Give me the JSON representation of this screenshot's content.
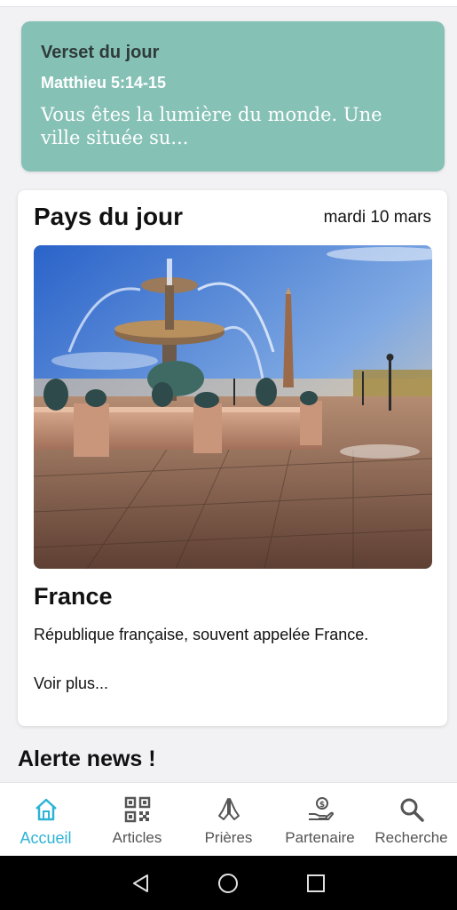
{
  "verse": {
    "title": "Verset du jour",
    "reference": "Matthieu 5:14-15",
    "text": "Vous êtes la lumière du monde. Une ville située su..."
  },
  "country_card": {
    "title": "Pays du jour",
    "date": "mardi 10 mars",
    "image_icon": "place-de-la-concorde-photo",
    "country": "France",
    "description": "République française, souvent appelée France.",
    "more_link": "Voir plus..."
  },
  "alerts": {
    "title": "Alerte news !"
  },
  "nav": {
    "items": [
      {
        "label": "Accueil",
        "icon": "home-icon",
        "active": true
      },
      {
        "label": "Articles",
        "icon": "qr-code-icon",
        "active": false
      },
      {
        "label": "Prières",
        "icon": "praying-hands-icon",
        "active": false
      },
      {
        "label": "Partenaire",
        "icon": "donate-hand-icon",
        "active": false
      },
      {
        "label": "Recherche",
        "icon": "search-icon",
        "active": false
      }
    ]
  },
  "colors": {
    "accent": "#2eb3d6",
    "verse_bg": "#86c1b6",
    "background": "#f2f2f4"
  }
}
